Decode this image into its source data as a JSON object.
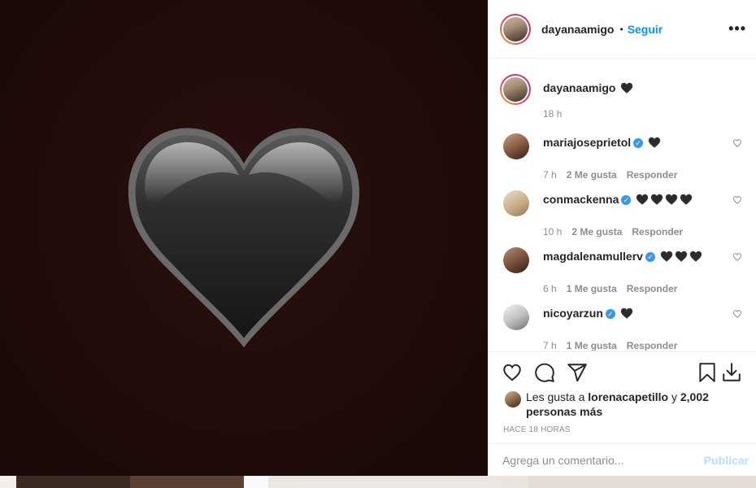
{
  "post": {
    "author": "dayanaamigo",
    "follow_label": "Seguir",
    "more_label": "•••",
    "media_emoji": "black-heart"
  },
  "caption": {
    "username": "dayanaamigo",
    "time": "18 h"
  },
  "comments": [
    {
      "username": "mariajoseprietol",
      "verified": true,
      "hearts": 1,
      "time": "7 h",
      "likes": "2 Me gusta",
      "reply": "Responder"
    },
    {
      "username": "conmackenna",
      "verified": true,
      "hearts": 4,
      "time": "10 h",
      "likes": "2 Me gusta",
      "reply": "Responder"
    },
    {
      "username": "magdalenamullerv",
      "verified": true,
      "hearts": 3,
      "time": "6 h",
      "likes": "1 Me gusta",
      "reply": "Responder"
    },
    {
      "username": "nicoyarzun",
      "verified": true,
      "hearts": 1,
      "time": "7 h",
      "likes": "1 Me gusta",
      "reply": "Responder"
    }
  ],
  "likes": {
    "prefix": "Les gusta a",
    "user": "lorenacapetillo",
    "conj": "y",
    "others": "2,002 personas más"
  },
  "posted_ago": "HACE 18 HORAS",
  "composer": {
    "placeholder": "Agrega un comentario...",
    "publish_label": "Publicar"
  },
  "colors": {
    "accent": "#0095f6",
    "publish_disabled": "#b2dffc",
    "verified": "#3897f0",
    "muted": "#8e8e8e"
  }
}
